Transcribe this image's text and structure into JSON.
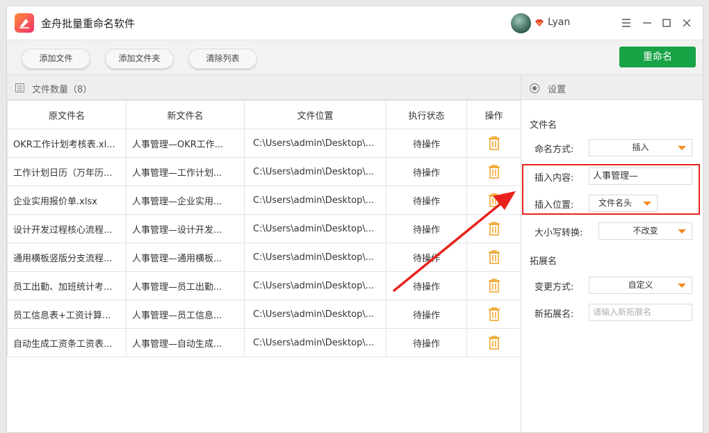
{
  "app": {
    "title": "金舟批量重命名软件",
    "username": "Lyan"
  },
  "toolbar": {
    "add_file": "添加文件",
    "add_folder": "添加文件夹",
    "clear_list": "清除列表",
    "rename": "重命名"
  },
  "file_list": {
    "count_label": "文件数量（8）",
    "columns": [
      "原文件名",
      "新文件名",
      "文件位置",
      "执行状态",
      "操作"
    ],
    "rows": [
      {
        "original": "OKR工作计划考核表.xl...",
        "new": "人事管理—OKR工作...",
        "location": "C:\\Users\\admin\\Desktop\\...",
        "status": "待操作"
      },
      {
        "original": "工作计划日历（万年历...",
        "new": "人事管理—工作计划...",
        "location": "C:\\Users\\admin\\Desktop\\...",
        "status": "待操作"
      },
      {
        "original": "企业实用报价单.xlsx",
        "new": "人事管理—企业实用...",
        "location": "C:\\Users\\admin\\Desktop\\...",
        "status": "待操作"
      },
      {
        "original": "设计开发过程核心流程...",
        "new": "人事管理—设计开发...",
        "location": "C:\\Users\\admin\\Desktop\\...",
        "status": "待操作"
      },
      {
        "original": "通用横板竖版分支流程...",
        "new": "人事管理—通用横板...",
        "location": "C:\\Users\\admin\\Desktop\\...",
        "status": "待操作"
      },
      {
        "original": "员工出勤、加班统计考...",
        "new": "人事管理—员工出勤...",
        "location": "C:\\Users\\admin\\Desktop\\...",
        "status": "待操作"
      },
      {
        "original": "员工信息表+工资计算...",
        "new": "人事管理—员工信息...",
        "location": "C:\\Users\\admin\\Desktop\\...",
        "status": "待操作"
      },
      {
        "original": "自动生成工资条工资表...",
        "new": "人事管理—自动生成...",
        "location": "C:\\Users\\admin\\Desktop\\...",
        "status": "待操作"
      }
    ]
  },
  "settings": {
    "title": "设置",
    "filename_section": "文件名",
    "naming_mode_label": "命名方式:",
    "naming_mode_value": "插入",
    "insert_content_label": "插入内容:",
    "insert_content_value": "人事管理—",
    "insert_position_label": "插入位置:",
    "insert_position_value": "文件名头",
    "case_label": "大小写转换:",
    "case_value": "不改变",
    "extension_section": "拓展名",
    "change_mode_label": "变更方式:",
    "change_mode_value": "自定义",
    "new_ext_label": "新拓展名:",
    "new_ext_placeholder": "请输入新拓展名"
  },
  "colors": {
    "accent_green": "#18a347",
    "dropdown_arrow": "#f5891e",
    "trash_icon": "#f0a020",
    "annotation_red": "#e8231d"
  }
}
